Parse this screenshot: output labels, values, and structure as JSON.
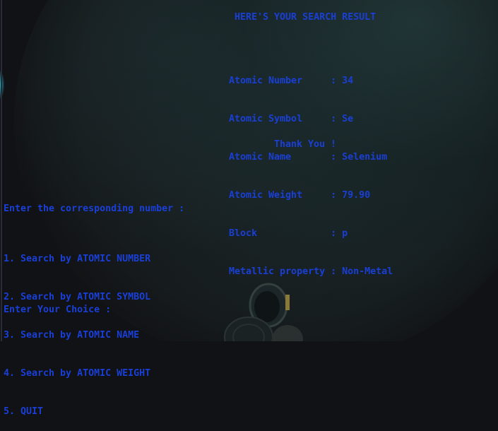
{
  "result": {
    "title": "HERE'S YOUR SEARCH RESULT",
    "rows": [
      {
        "label": "Atomic Number     ",
        "value": "34"
      },
      {
        "label": "Atomic Symbol     ",
        "value": "Se"
      },
      {
        "label": "Atomic Name       ",
        "value": "Selenium"
      },
      {
        "label": "Atomic Weight     ",
        "value": "79.90"
      },
      {
        "label": "Block             ",
        "value": "p"
      },
      {
        "label": "Metallic property ",
        "value": "Non-Metal"
      }
    ],
    "separator": ": ",
    "thanks": "Thank You !"
  },
  "menu": {
    "prompt": "Enter the corresponding number :",
    "options": [
      "1. Search by ATOMIC NUMBER",
      "2. Search by ATOMIC SYMBOL",
      "3. Search by ATOMIC NAME",
      "4. Search by ATOMIC WEIGHT",
      "5. QUIT"
    ],
    "choice_prompt": "Enter Your Choice : "
  },
  "colors": {
    "text": "#1a3fd6",
    "background": "#111215"
  }
}
